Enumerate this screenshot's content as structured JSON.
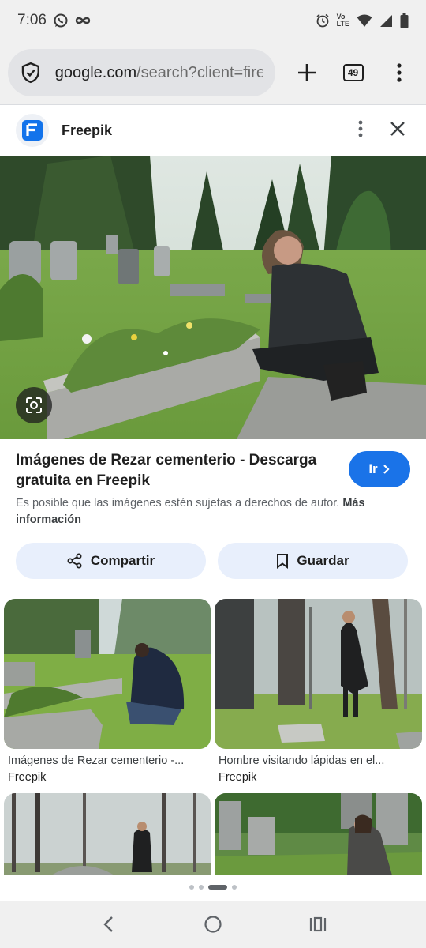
{
  "status_bar": {
    "time": "7:06",
    "network_label_top": "Vo",
    "network_label_bottom": "LTE"
  },
  "browser": {
    "url_domain": "google.com",
    "url_path": "/search?client=fire",
    "tab_count": "49"
  },
  "source": {
    "name": "Freepik"
  },
  "result": {
    "title": "Imágenes de Rezar cementerio - Descarga gratuita en Freepik",
    "visit_label": "Ir",
    "copyright_notice": "Es posible que las imágenes estén sujetas a derechos de autor.",
    "more_info": "Más información"
  },
  "actions": {
    "share_label": "Compartir",
    "save_label": "Guardar"
  },
  "related": [
    {
      "title": "Imágenes de Rezar cementerio -...",
      "source": "Freepik"
    },
    {
      "title": "Hombre visitando lápidas en el...",
      "source": "Freepik"
    }
  ],
  "icons": {
    "shield": "shield-icon",
    "new_tab": "plus-icon",
    "menu": "more-vert-icon",
    "close": "close-icon",
    "lens": "lens-icon",
    "share": "share-icon",
    "bookmark": "bookmark-icon"
  },
  "colors": {
    "accent": "#1a73e8",
    "chip_bg": "#e8effc",
    "brand": "#1273eb"
  }
}
